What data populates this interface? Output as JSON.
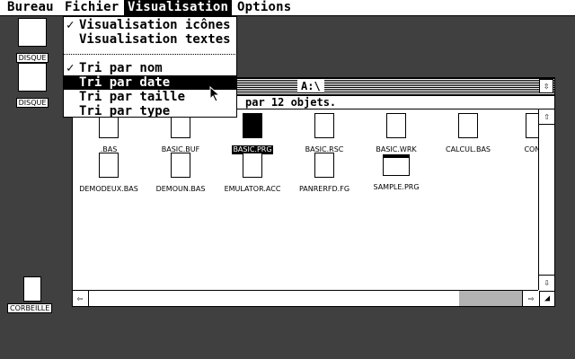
{
  "menubar": {
    "items": [
      "Bureau",
      "Fichier",
      "Visualisation",
      "Options"
    ],
    "active": "Visualisation"
  },
  "desktop": {
    "drive1_label": "DISQUE",
    "drive2_label": "DISQUE",
    "trash_label": "CORBEILLE"
  },
  "dropdown": {
    "items": [
      {
        "label": "Visualisation icônes",
        "checked": true
      },
      {
        "label": "Visualisation textes",
        "checked": false
      },
      {
        "label": "Tri par nom",
        "checked": true
      },
      {
        "label": "Tri par date",
        "checked": false,
        "highlighted": true
      },
      {
        "label": "Tri par taille",
        "checked": false
      },
      {
        "label": "Tri par type",
        "checked": false
      }
    ],
    "check_glyph": "✓"
  },
  "window": {
    "title": "A:\\",
    "info": "par 12 objets.",
    "fuller_glyph": "⇳",
    "scroll_up": "⇧",
    "scroll_down": "⇩",
    "scroll_left": "⇦",
    "scroll_right": "⇨",
    "sizer_glyph": "◢"
  },
  "files": [
    {
      "name": ".BAS",
      "type": "doc"
    },
    {
      "name": "BASIC.BUF",
      "type": "doc"
    },
    {
      "name": "BASIC.PRG",
      "type": "doc",
      "selected": true
    },
    {
      "name": "BASIC.RSC",
      "type": "doc"
    },
    {
      "name": "BASIC.WRK",
      "type": "doc"
    },
    {
      "name": "CALCUL.BAS",
      "type": "doc"
    },
    {
      "name": "CONTI",
      "type": "doc"
    },
    {
      "name": "DEMODEUX.BAS",
      "type": "doc"
    },
    {
      "name": "DEMOUN.BAS",
      "type": "doc"
    },
    {
      "name": "EMULATOR.ACC",
      "type": "doc"
    },
    {
      "name": "PANRERFD.FG",
      "type": "doc"
    },
    {
      "name": "SAMPLE.PRG",
      "type": "prg"
    }
  ]
}
